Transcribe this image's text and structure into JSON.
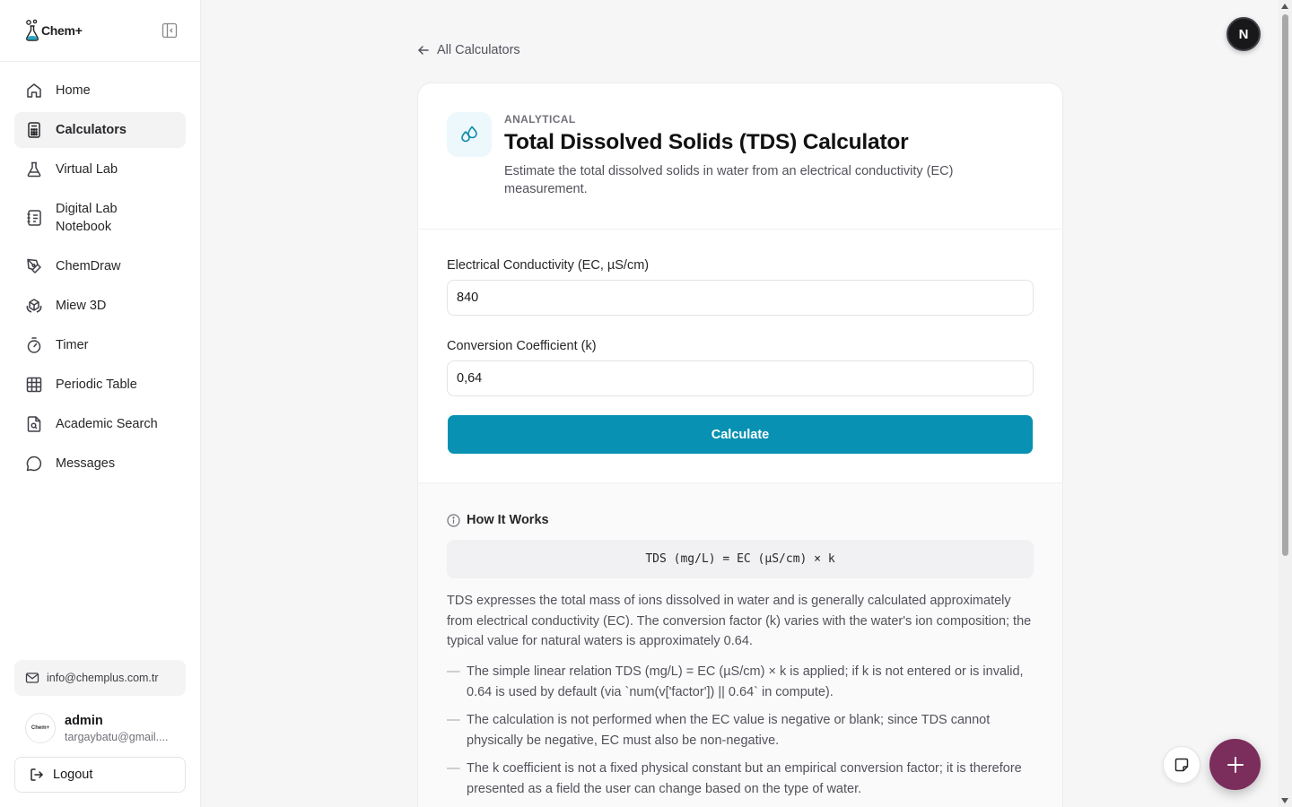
{
  "brand": {
    "name": "Chem+",
    "icon": "flask-icon"
  },
  "sidebar": {
    "items": [
      {
        "label": "Home",
        "icon": "home-icon",
        "active": false
      },
      {
        "label": "Calculators",
        "icon": "calculator-icon",
        "active": true
      },
      {
        "label": "Virtual Lab",
        "icon": "beaker-icon",
        "active": false
      },
      {
        "label": "Digital Lab Notebook",
        "icon": "notebook-icon",
        "active": false
      },
      {
        "label": "ChemDraw",
        "icon": "pen-tool-icon",
        "active": false
      },
      {
        "label": "Miew 3D",
        "icon": "rotate-3d-icon",
        "active": false
      },
      {
        "label": "Timer",
        "icon": "timer-icon",
        "active": false
      },
      {
        "label": "Periodic Table",
        "icon": "grid-icon",
        "active": false
      },
      {
        "label": "Academic Search",
        "icon": "file-search-icon",
        "active": false
      },
      {
        "label": "Messages",
        "icon": "message-icon",
        "active": false
      }
    ],
    "contact_email": "info@chemplus.com.tr",
    "user": {
      "name": "admin",
      "email": "targaybatu@gmail....",
      "avatar_text": "Chem+"
    },
    "logout_label": "Logout"
  },
  "header": {
    "back_label": "All Calculators",
    "avatar_initial": "N"
  },
  "calculator": {
    "category": "ANALYTICAL",
    "title": "Total Dissolved Solids (TDS) Calculator",
    "description": "Estimate the total dissolved solids in water from an electrical conductivity (EC) measurement.",
    "fields": [
      {
        "label": "Electrical Conductivity (EC, µS/cm)",
        "value": "840"
      },
      {
        "label": "Conversion Coefficient (k)",
        "value": "0,64"
      }
    ],
    "button_label": "Calculate"
  },
  "how_it_works": {
    "title": "How It Works",
    "formula": "TDS (mg/L) = EC (µS/cm) × k",
    "text": "TDS expresses the total mass of ions dissolved in water and is generally calculated approximately from electrical conductivity (EC). The conversion factor (k) varies with the water's ion composition; the typical value for natural waters is approximately 0.64.",
    "bullets": [
      "The simple linear relation TDS (mg/L) = EC (µS/cm) × k is applied; if k is not entered or is invalid, 0.64 is used by default (via `num(v['factor']) || 0.64` in compute).",
      "The calculation is not performed when the EC value is negative or blank; since TDS cannot physically be negative, EC must also be non-negative.",
      "The k coefficient is not a fixed physical constant but an empirical conversion factor; it is therefore presented as a field the user can change based on the type of water."
    ]
  },
  "colors": {
    "accent": "#0891b2",
    "fab": "#7b2d5c"
  }
}
